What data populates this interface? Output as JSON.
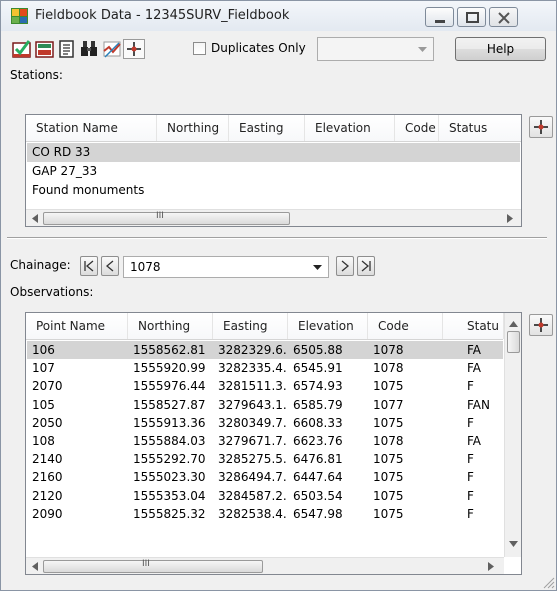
{
  "window": {
    "title": "Fieldbook Data - 12345SURV_Fieldbook",
    "icon": "fieldbook-app-icon"
  },
  "toolbar": {
    "icons": [
      "checkmark-report-icon",
      "import-fieldbook-icon",
      "notes-icon",
      "binoculars-icon",
      "edit-chart-icon",
      "add-point-icon"
    ],
    "duplicates_only_label": "Duplicates Only",
    "duplicates_only_checked": false,
    "filter_value": "",
    "help_label": "Help"
  },
  "stations": {
    "label": "Stations:",
    "columns": [
      "Station Name",
      "Northing",
      "Easting",
      "Elevation",
      "Code",
      "Status"
    ],
    "rows": [
      {
        "name": "CO RD 33",
        "selected": true
      },
      {
        "name": "GAP 27_33",
        "selected": false
      },
      {
        "name": "Found monuments",
        "selected": false
      }
    ]
  },
  "chainage": {
    "label": "Chainage:",
    "value": "1078"
  },
  "observations": {
    "label": "Observations:",
    "columns": [
      "Point Name",
      "Northing",
      "Easting",
      "Elevation",
      "Code",
      "Statu"
    ],
    "rows": [
      {
        "point": "106",
        "northing": "1558562.81",
        "easting": "3282329.6...",
        "elevation": "6505.88",
        "code": "1078",
        "status": "FA",
        "selected": true
      },
      {
        "point": "107",
        "northing": "1555920.99",
        "easting": "3282335.4...",
        "elevation": "6545.91",
        "code": "1078",
        "status": "FA",
        "selected": false
      },
      {
        "point": "2070",
        "northing": "1555976.44",
        "easting": "3281511.3...",
        "elevation": "6574.93",
        "code": "1075",
        "status": "F",
        "selected": false
      },
      {
        "point": "105",
        "northing": "1558527.87",
        "easting": "3279643.1...",
        "elevation": "6585.79",
        "code": "1077",
        "status": "FAN",
        "selected": false
      },
      {
        "point": "2050",
        "northing": "1555913.36",
        "easting": "3280349.7...",
        "elevation": "6608.33",
        "code": "1075",
        "status": "F",
        "selected": false
      },
      {
        "point": "108",
        "northing": "1555884.03",
        "easting": "3279671.7...",
        "elevation": "6623.76",
        "code": "1078",
        "status": "FA",
        "selected": false
      },
      {
        "point": "2140",
        "northing": "1555292.70",
        "easting": "3285275.5...",
        "elevation": "6476.81",
        "code": "1075",
        "status": "F",
        "selected": false
      },
      {
        "point": "2160",
        "northing": "1555023.30",
        "easting": "3286494.7...",
        "elevation": "6447.64",
        "code": "1075",
        "status": "F",
        "selected": false
      },
      {
        "point": "2120",
        "northing": "1555353.04",
        "easting": "3284587.2...",
        "elevation": "6503.54",
        "code": "1075",
        "status": "F",
        "selected": false
      },
      {
        "point": "2090",
        "northing": "1555825.32",
        "easting": "3282538.4...",
        "elevation": "6547.98",
        "code": "1075",
        "status": "F",
        "selected": false
      }
    ]
  },
  "scrollbar_grip": "III",
  "colors": {
    "selected_row": "#d4d4d4",
    "window_bg": "#f0f0f0"
  }
}
